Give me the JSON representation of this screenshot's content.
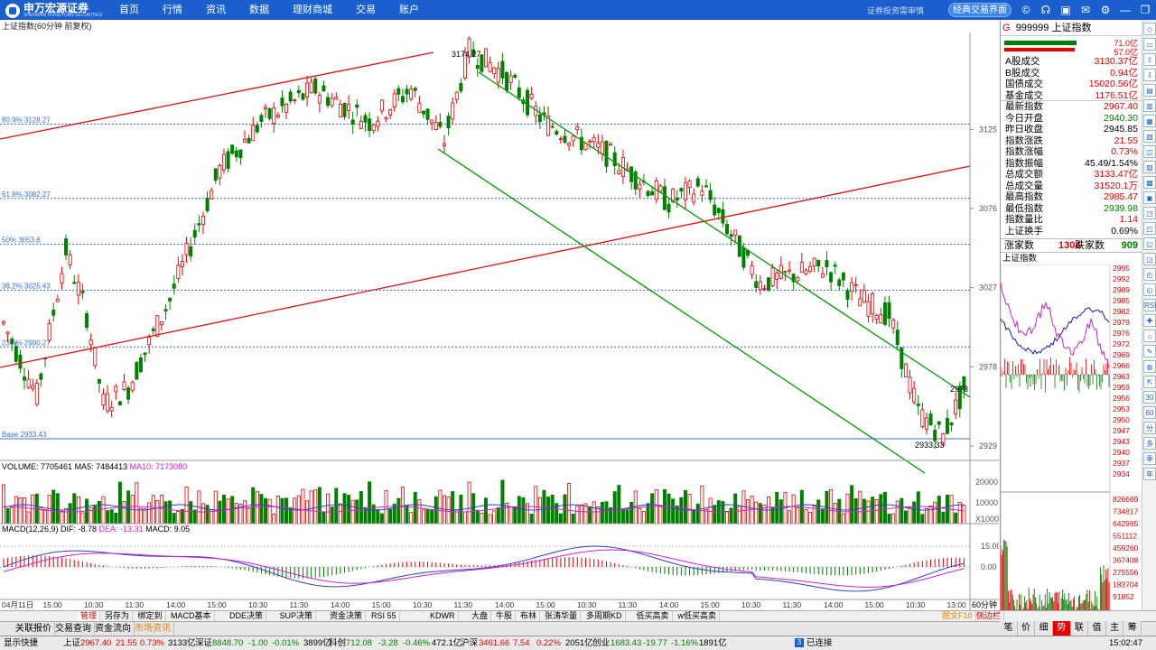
{
  "app": {
    "logo": "申万宏源证券",
    "logo_sub": "SHENWAN HONGYUAN SECURITIES",
    "menu": [
      "首页",
      "行情",
      "资讯",
      "数据",
      "理财商城",
      "交易",
      "账户"
    ],
    "slogan": "证券投资需审慎",
    "classic_button": "经典交易界面",
    "window_icons": [
      "copyright-icon",
      "headset-icon",
      "layout-icon",
      "mail-icon",
      "settings-icon",
      "minimize-icon",
      "restore-icon",
      "close-icon"
    ]
  },
  "chart_header": {
    "title": "上证指数(60分钟 前复权)",
    "top_price_label": "3174.27",
    "bottom_price_label": "2933.33",
    "last_price_label": "2973"
  },
  "fib_levels": [
    {
      "label": "80.9% 3128.27",
      "value": 3128.27
    },
    {
      "label": "61.8% 3082.27",
      "value": 3082.27
    },
    {
      "label": "50% 3053.8",
      "value": 3053.8
    },
    {
      "label": "38.2% 3025.43",
      "value": 3025.43
    },
    {
      "label": "23.6% 2990.27",
      "value": 2990.27
    },
    {
      "label": "Base 2933.43",
      "value": 2933.43
    }
  ],
  "price_axis": [
    "3125",
    "3076",
    "3027",
    "2978",
    "2929"
  ],
  "volume": {
    "label": "VOLUME: 7705461",
    "ma5": "MA5: 7484413",
    "ma10": "MA10: 7173080",
    "axis": [
      "20000",
      "10000",
      "X1000"
    ]
  },
  "macd": {
    "label": "MACD(12,26,9)",
    "dif": "DIF: -8.78",
    "dea": "DEA: -13.31",
    "macd": "MACD: 9.05",
    "axis": [
      "15.00",
      "0.00"
    ]
  },
  "time_axis": [
    "04月11日",
    "15:00",
    "10:30",
    "11:30",
    "14:00",
    "15:00",
    "10:30",
    "11:30",
    "14:00",
    "15:00",
    "10:30",
    "11:30",
    "14:00",
    "15:00",
    "10:30",
    "11:30",
    "14:00",
    "15:00",
    "10:30",
    "11:30",
    "14:00",
    "15:00",
    "10:30",
    "13:00"
  ],
  "period": "60分钟",
  "quote": {
    "code_prefix": "G",
    "code": "999999 上证指数",
    "bar1": "71.0亿",
    "bar2": "57.0亿",
    "rows": [
      {
        "k": "A股成交",
        "v": "3130.37亿",
        "c": "red"
      },
      {
        "k": "B股成交",
        "v": "0.94亿",
        "c": "red"
      },
      {
        "k": "国债成交",
        "v": "15020.56亿",
        "c": "red"
      },
      {
        "k": "基金成交",
        "v": "1176.51亿",
        "c": "red"
      },
      {
        "k": "最新指数",
        "v": "2967.40",
        "c": "red"
      },
      {
        "k": "今日开盘",
        "v": "2940.30",
        "c": "grn"
      },
      {
        "k": "昨日收盘",
        "v": "2945.85",
        "c": "blk"
      },
      {
        "k": "指数涨跌",
        "v": "21.55",
        "c": "red"
      },
      {
        "k": "指数涨幅",
        "v": "0.73%",
        "c": "red"
      },
      {
        "k": "指数振幅",
        "v": "45.49/1.54%",
        "c": "blk"
      },
      {
        "k": "总成交额",
        "v": "3133.47亿",
        "c": "red"
      },
      {
        "k": "总成交量",
        "v": "31520.1万",
        "c": "red"
      },
      {
        "k": "最高指数",
        "v": "2985.47",
        "c": "red"
      },
      {
        "k": "最低指数",
        "v": "2939.98",
        "c": "grn"
      },
      {
        "k": "指数量比",
        "v": "1.14",
        "c": "red"
      },
      {
        "k": "上证换手",
        "v": "0.69%",
        "c": "blk"
      }
    ],
    "up_label": "涨家数",
    "up": "1304",
    "down_label": "跌家数",
    "down": "909",
    "mini_title": "上证指数",
    "mini_axis": [
      "2995",
      "2992",
      "2989",
      "2985",
      "2982",
      "2979",
      "2976",
      "2972",
      "2969",
      "2966",
      "2963",
      "2959",
      "2956",
      "2953",
      "2950",
      "2947",
      "2943",
      "2940",
      "2937",
      "2934",
      "826669",
      "734817",
      "642965",
      "551112",
      "459260",
      "367408",
      "275556",
      "183704",
      "91852"
    ]
  },
  "tabs": [
    "管理",
    "另存为",
    "绑定到",
    "MACD基本",
    "DDE决策",
    "SUP决策",
    "资金决策",
    "RSI 55",
    "KDWR",
    "大盘",
    "牛股",
    "布林",
    "张涛华量",
    "多周期KD",
    "低买高卖",
    "w低买高卖"
  ],
  "tab_right": [
    "图文F10",
    "侧边栏"
  ],
  "links": [
    "关联报价",
    "交易查询",
    "资金流向",
    "市场资讯"
  ],
  "rp_tabs": [
    "笔",
    "价",
    "细",
    "势",
    "联",
    "值",
    "主",
    "筹"
  ],
  "status": {
    "show": "显示快捷",
    "sh_name": "上证",
    "sh_price": "2967.40",
    "sh_chg": "21.55",
    "sh_pct": "0.73%",
    "sh_amt": "3133亿",
    "sz_name": "深证",
    "sz_price": "8848.70",
    "sz_chg": "-1.00",
    "sz_pct": "-0.01%",
    "sz_amt": "3899亿",
    "kc_name": "科创",
    "kc_price": "712.08",
    "kc_chg": "-3.28",
    "kc_pct": "-0.46%",
    "kc_amt": "472.1亿",
    "hs_name": "沪深",
    "hs_price": "3461.66",
    "hs_chg": "7.54",
    "hs_pct": "0.22%",
    "hs_amt": "2051亿",
    "cy_name": "创业",
    "cy_price": "1683.43",
    "cy_chg": "-19.77",
    "cy_pct": "-1.16%",
    "cy_amt": "1891亿",
    "conn": "已连接",
    "time": "15:02:47"
  },
  "colors": {
    "up": "#e60000",
    "down": "#008000",
    "channel_red": "#d11",
    "channel_green": "#090",
    "fib": "#3a6fd8",
    "ma_blue": "#3040c0",
    "ma_pink": "#d020d0"
  }
}
